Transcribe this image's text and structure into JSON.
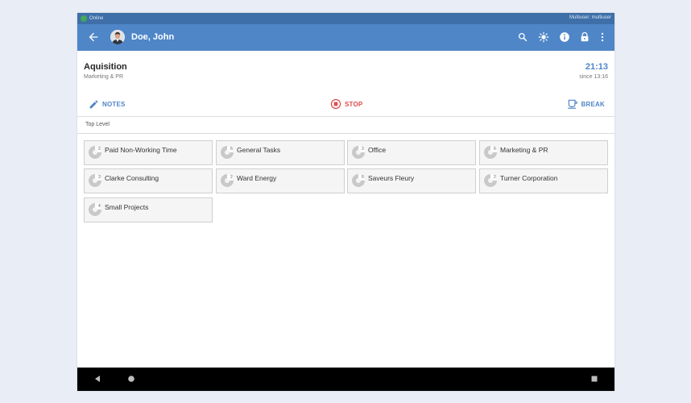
{
  "status_bar": {
    "connection": "Online",
    "user": "Multiuser: multiuser",
    "online_color": "#43a85a"
  },
  "app_bar": {
    "user_name": "Doe, John",
    "icons": [
      "back-arrow-icon",
      "search-icon",
      "brightness-icon",
      "info-icon",
      "lock-icon",
      "more-vert-icon"
    ],
    "color": "#4e86c8"
  },
  "current": {
    "project": "Aquisition",
    "department": "Marketing & PR",
    "time": "21:13",
    "since": "since 13:16"
  },
  "actions": {
    "notes": "NOTES",
    "stop": "STOP",
    "break": "BREAK"
  },
  "breadcrumb": "Top Level",
  "tiles": [
    {
      "label": "Paid Non-Working Time",
      "badge": "2"
    },
    {
      "label": "General Tasks",
      "badge": "6"
    },
    {
      "label": "Office",
      "badge": "2"
    },
    {
      "label": "Marketing & PR",
      "badge": "6"
    },
    {
      "label": "Clarke Consulting",
      "badge": "3"
    },
    {
      "label": "Ward Energy",
      "badge": "2"
    },
    {
      "label": "Saveurs Fleury",
      "badge": "6"
    },
    {
      "label": "Turner Corporation",
      "badge": "2"
    },
    {
      "label": "Small Projects",
      "badge": "4"
    }
  ]
}
